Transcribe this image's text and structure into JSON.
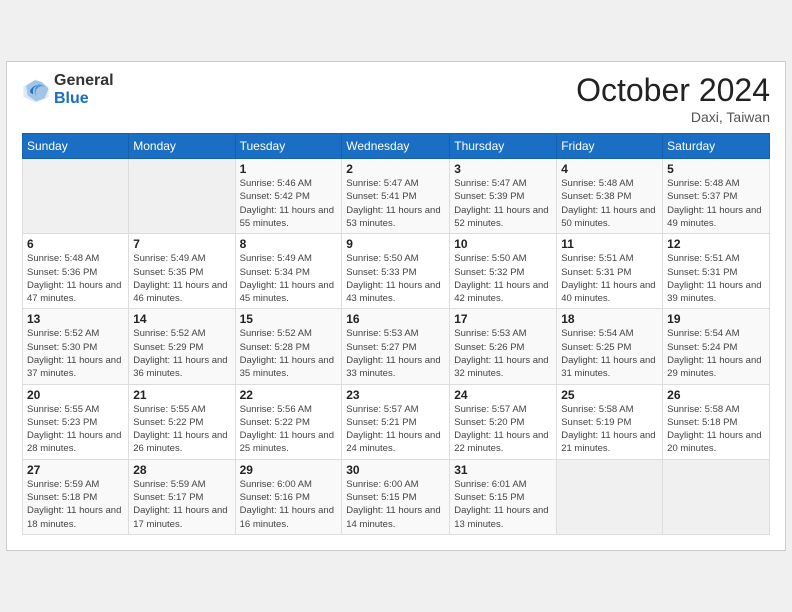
{
  "header": {
    "logo_general": "General",
    "logo_blue": "Blue",
    "month_title": "October 2024",
    "location": "Daxi, Taiwan"
  },
  "weekdays": [
    "Sunday",
    "Monday",
    "Tuesday",
    "Wednesday",
    "Thursday",
    "Friday",
    "Saturday"
  ],
  "weeks": [
    [
      {
        "day": "",
        "info": ""
      },
      {
        "day": "",
        "info": ""
      },
      {
        "day": "1",
        "info": "Sunrise: 5:46 AM\nSunset: 5:42 PM\nDaylight: 11 hours and 55 minutes."
      },
      {
        "day": "2",
        "info": "Sunrise: 5:47 AM\nSunset: 5:41 PM\nDaylight: 11 hours and 53 minutes."
      },
      {
        "day": "3",
        "info": "Sunrise: 5:47 AM\nSunset: 5:39 PM\nDaylight: 11 hours and 52 minutes."
      },
      {
        "day": "4",
        "info": "Sunrise: 5:48 AM\nSunset: 5:38 PM\nDaylight: 11 hours and 50 minutes."
      },
      {
        "day": "5",
        "info": "Sunrise: 5:48 AM\nSunset: 5:37 PM\nDaylight: 11 hours and 49 minutes."
      }
    ],
    [
      {
        "day": "6",
        "info": "Sunrise: 5:48 AM\nSunset: 5:36 PM\nDaylight: 11 hours and 47 minutes."
      },
      {
        "day": "7",
        "info": "Sunrise: 5:49 AM\nSunset: 5:35 PM\nDaylight: 11 hours and 46 minutes."
      },
      {
        "day": "8",
        "info": "Sunrise: 5:49 AM\nSunset: 5:34 PM\nDaylight: 11 hours and 45 minutes."
      },
      {
        "day": "9",
        "info": "Sunrise: 5:50 AM\nSunset: 5:33 PM\nDaylight: 11 hours and 43 minutes."
      },
      {
        "day": "10",
        "info": "Sunrise: 5:50 AM\nSunset: 5:32 PM\nDaylight: 11 hours and 42 minutes."
      },
      {
        "day": "11",
        "info": "Sunrise: 5:51 AM\nSunset: 5:31 PM\nDaylight: 11 hours and 40 minutes."
      },
      {
        "day": "12",
        "info": "Sunrise: 5:51 AM\nSunset: 5:31 PM\nDaylight: 11 hours and 39 minutes."
      }
    ],
    [
      {
        "day": "13",
        "info": "Sunrise: 5:52 AM\nSunset: 5:30 PM\nDaylight: 11 hours and 37 minutes."
      },
      {
        "day": "14",
        "info": "Sunrise: 5:52 AM\nSunset: 5:29 PM\nDaylight: 11 hours and 36 minutes."
      },
      {
        "day": "15",
        "info": "Sunrise: 5:52 AM\nSunset: 5:28 PM\nDaylight: 11 hours and 35 minutes."
      },
      {
        "day": "16",
        "info": "Sunrise: 5:53 AM\nSunset: 5:27 PM\nDaylight: 11 hours and 33 minutes."
      },
      {
        "day": "17",
        "info": "Sunrise: 5:53 AM\nSunset: 5:26 PM\nDaylight: 11 hours and 32 minutes."
      },
      {
        "day": "18",
        "info": "Sunrise: 5:54 AM\nSunset: 5:25 PM\nDaylight: 11 hours and 31 minutes."
      },
      {
        "day": "19",
        "info": "Sunrise: 5:54 AM\nSunset: 5:24 PM\nDaylight: 11 hours and 29 minutes."
      }
    ],
    [
      {
        "day": "20",
        "info": "Sunrise: 5:55 AM\nSunset: 5:23 PM\nDaylight: 11 hours and 28 minutes."
      },
      {
        "day": "21",
        "info": "Sunrise: 5:55 AM\nSunset: 5:22 PM\nDaylight: 11 hours and 26 minutes."
      },
      {
        "day": "22",
        "info": "Sunrise: 5:56 AM\nSunset: 5:22 PM\nDaylight: 11 hours and 25 minutes."
      },
      {
        "day": "23",
        "info": "Sunrise: 5:57 AM\nSunset: 5:21 PM\nDaylight: 11 hours and 24 minutes."
      },
      {
        "day": "24",
        "info": "Sunrise: 5:57 AM\nSunset: 5:20 PM\nDaylight: 11 hours and 22 minutes."
      },
      {
        "day": "25",
        "info": "Sunrise: 5:58 AM\nSunset: 5:19 PM\nDaylight: 11 hours and 21 minutes."
      },
      {
        "day": "26",
        "info": "Sunrise: 5:58 AM\nSunset: 5:18 PM\nDaylight: 11 hours and 20 minutes."
      }
    ],
    [
      {
        "day": "27",
        "info": "Sunrise: 5:59 AM\nSunset: 5:18 PM\nDaylight: 11 hours and 18 minutes."
      },
      {
        "day": "28",
        "info": "Sunrise: 5:59 AM\nSunset: 5:17 PM\nDaylight: 11 hours and 17 minutes."
      },
      {
        "day": "29",
        "info": "Sunrise: 6:00 AM\nSunset: 5:16 PM\nDaylight: 11 hours and 16 minutes."
      },
      {
        "day": "30",
        "info": "Sunrise: 6:00 AM\nSunset: 5:15 PM\nDaylight: 11 hours and 14 minutes."
      },
      {
        "day": "31",
        "info": "Sunrise: 6:01 AM\nSunset: 5:15 PM\nDaylight: 11 hours and 13 minutes."
      },
      {
        "day": "",
        "info": ""
      },
      {
        "day": "",
        "info": ""
      }
    ]
  ]
}
